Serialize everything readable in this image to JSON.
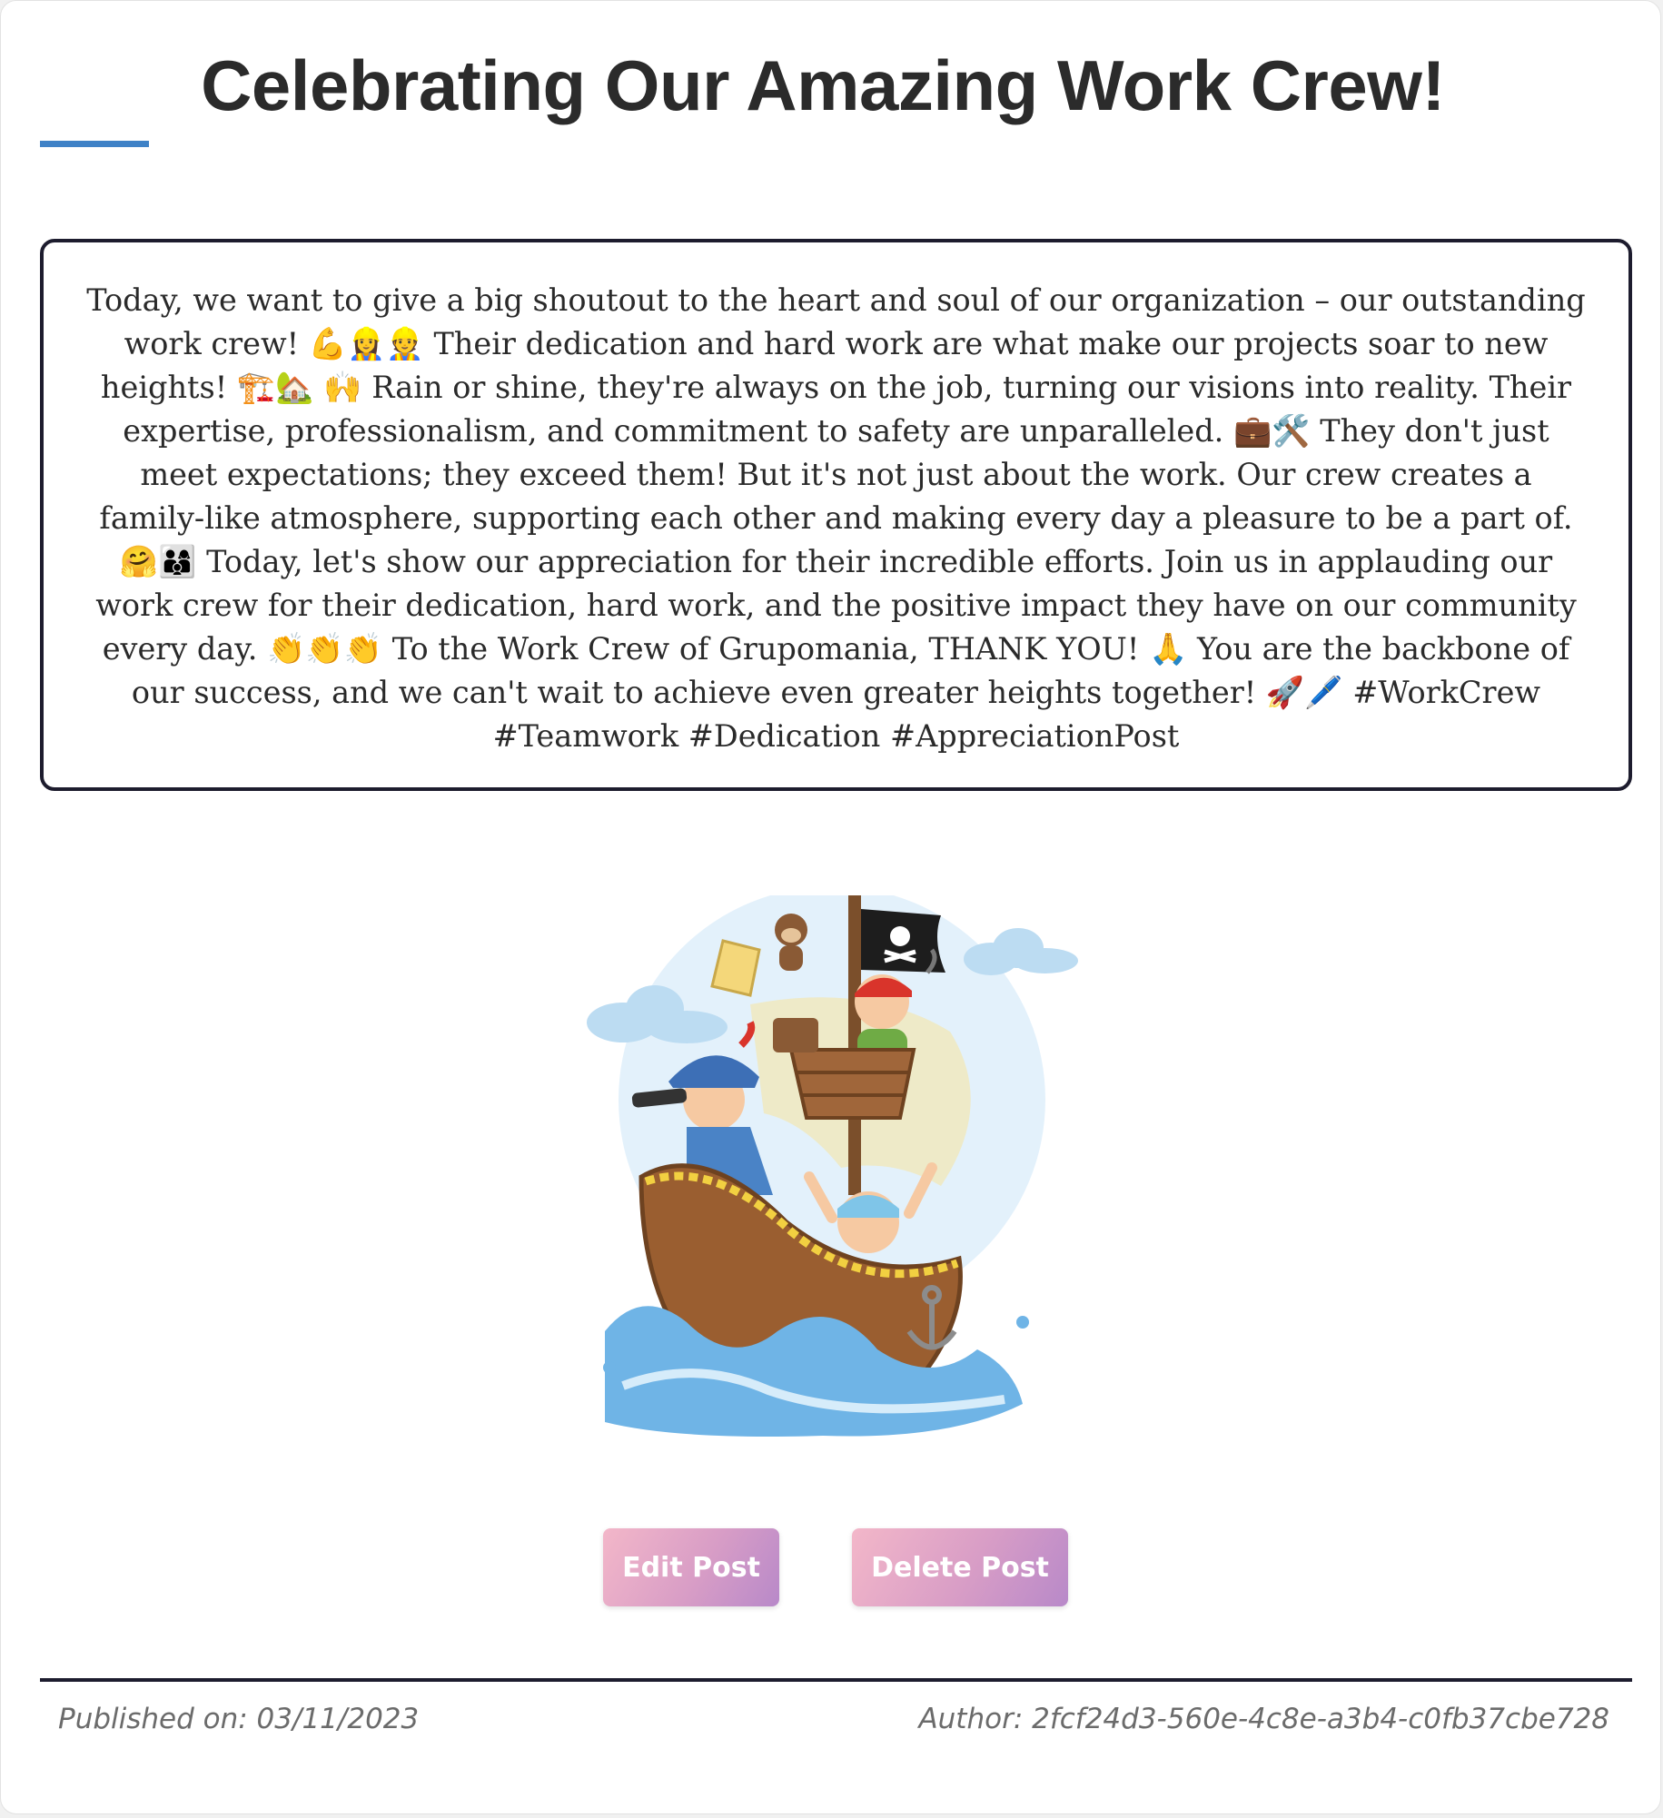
{
  "post": {
    "title": "Celebrating Our Amazing Work Crew!",
    "segments": [
      "Today, we want to give a big shoutout to the heart and soul of our organization – our outstanding work crew! ",
      "💪👷‍♀️👷",
      " Their dedication and hard work are what make our projects soar to new heights! ",
      "🏗️🏡 🙌",
      " Rain or shine, they're always on the job, turning our visions into reality. Their expertise, professionalism, and commitment to safety are unparalleled. ",
      "💼🛠️",
      " They don't just meet expectations; they exceed them! But it's not just about the work. Our crew creates a family-like atmosphere, supporting each other and making every day a pleasure to be a part of. ",
      "🤗👨‍👩‍👦",
      " Today, let's show our appreciation for their incredible efforts. Join us in applauding our work crew for their dedication, hard work, and the positive impact they have on our community every day. ",
      "👏👏👏",
      " To the Work Crew of Grupomania, THANK YOU! ",
      "🙏",
      " You are the backbone of our success, and we can't wait to achieve even greater heights together! ",
      "🚀🖊️",
      " #WorkCrew #Teamwork #Dedication #AppreciationPost"
    ],
    "image_alt": "pirate-ship-crew-illustration"
  },
  "actions": {
    "edit_label": "Edit Post",
    "delete_label": "Delete Post"
  },
  "footer": {
    "published": "Published on: 03/11/2023",
    "author": "Author: 2fcf24d3-560e-4c8e-a3b4-c0fb37cbe728"
  },
  "colors": {
    "accent_underline": "#3f82c7",
    "box_border": "#1d1c2e",
    "button_gradient_start": "#f3b7c9",
    "button_gradient_end": "#b889c9"
  }
}
